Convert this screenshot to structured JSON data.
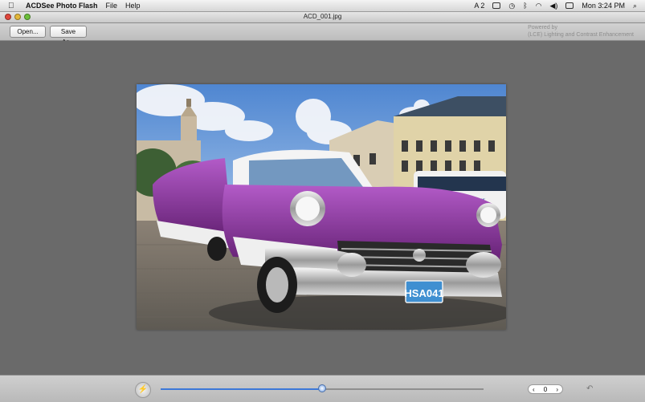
{
  "menubar": {
    "app_name": "ACDSee Photo Flash",
    "items": [
      "File",
      "Help"
    ],
    "status": {
      "input_badge": "A 2",
      "clock": "Mon 3:24 PM"
    }
  },
  "window": {
    "title": "ACD_001.jpg"
  },
  "toolbar": {
    "open_label": "Open...",
    "save_as_label": "Save As...",
    "powered_by_line1": "Powered by",
    "powered_by_line2": "(LCE) Lighting and Contrast Enhancement"
  },
  "image": {
    "plate_text": "HSA041"
  },
  "bottom": {
    "slider_value_fraction": 0.5,
    "stepper_value": "0",
    "stepper_left": "‹",
    "stepper_right": "›",
    "auto_symbol": "⚡",
    "undo_symbol": "↶"
  },
  "colors": {
    "accent": "#3c78d8",
    "car_body": "#7a2a8a"
  }
}
